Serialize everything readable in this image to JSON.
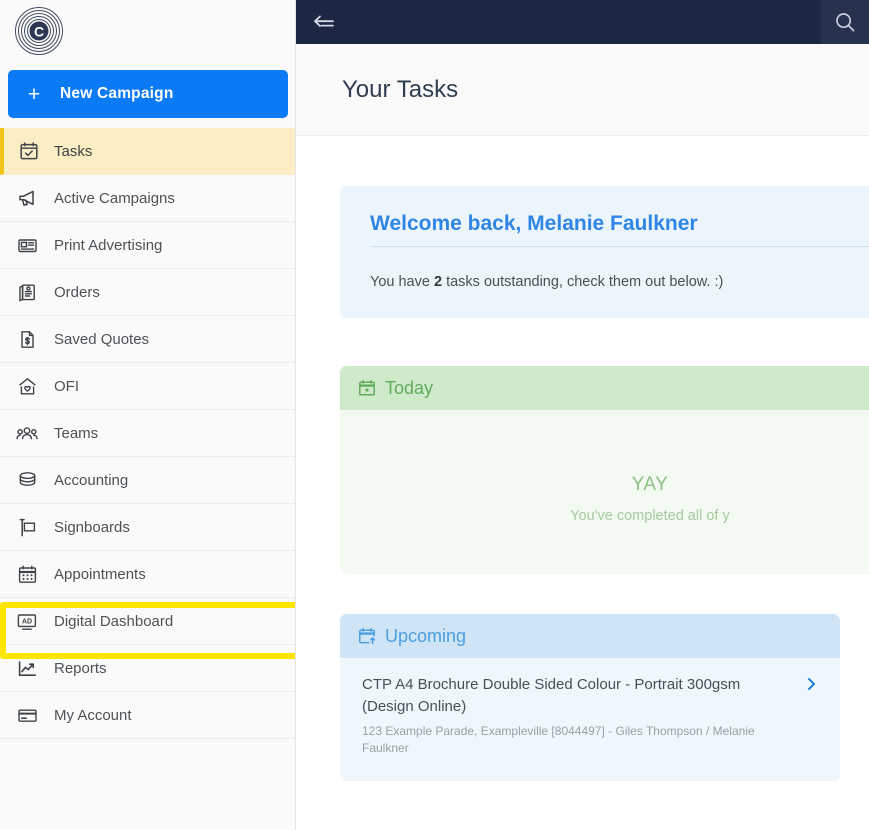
{
  "brand": {
    "logo_icon": "concentric-circles-c-logo",
    "accent_blue": "#0b7bf5",
    "topbar_navy": "#1c2744",
    "highlight_yellow": "#ffe600",
    "active_gold": "#fbeec4"
  },
  "sidebar": {
    "new_campaign": {
      "label": "New Campaign",
      "plus_icon": "plus-icon"
    },
    "items": [
      {
        "label": "Tasks",
        "icon": "calendar-check-icon",
        "active": true
      },
      {
        "label": "Active Campaigns",
        "icon": "megaphone-icon",
        "active": false
      },
      {
        "label": "Print Advertising",
        "icon": "newspaper-icon",
        "active": false
      },
      {
        "label": "Orders",
        "icon": "brochure-icon",
        "active": false
      },
      {
        "label": "Saved Quotes",
        "icon": "document-dollar-icon",
        "active": false
      },
      {
        "label": "OFI",
        "icon": "house-heart-icon",
        "active": false
      },
      {
        "label": "Teams",
        "icon": "people-group-icon",
        "active": false
      },
      {
        "label": "Accounting",
        "icon": "coins-stack-icon",
        "active": false
      },
      {
        "label": "Signboards",
        "icon": "signboard-icon",
        "active": false
      },
      {
        "label": "Appointments",
        "icon": "calendar-grid-icon",
        "active": false
      },
      {
        "label": "Digital Dashboard",
        "icon": "ad-monitor-icon",
        "active": false
      },
      {
        "label": "Reports",
        "icon": "line-chart-icon",
        "active": false
      },
      {
        "label": "My Account",
        "icon": "credit-card-icon",
        "active": false
      }
    ]
  },
  "topbar": {
    "collapse_icon": "collapse-arrow-left-icon",
    "search_icon": "search-icon"
  },
  "page": {
    "title": "Your Tasks"
  },
  "welcome": {
    "title": "Welcome back, Melanie Faulkner",
    "text_before": "You have ",
    "count": "2",
    "text_after": " tasks outstanding, check them out below. :)"
  },
  "today": {
    "heading": "Today",
    "icon": "calendar-today-icon",
    "empty_title": "YAY",
    "empty_sub": "You've completed all of y"
  },
  "upcoming": {
    "heading": "Upcoming",
    "icon": "calendar-upcoming-icon",
    "chevron_icon": "chevron-right-icon",
    "tasks": [
      {
        "title": "CTP A4 Brochure Double Sided Colour - Portrait 300gsm (Design Online)",
        "meta": "123 Example Parade, Exampleville [8044497] - Giles Thompson / Melanie Faulkner"
      }
    ]
  }
}
